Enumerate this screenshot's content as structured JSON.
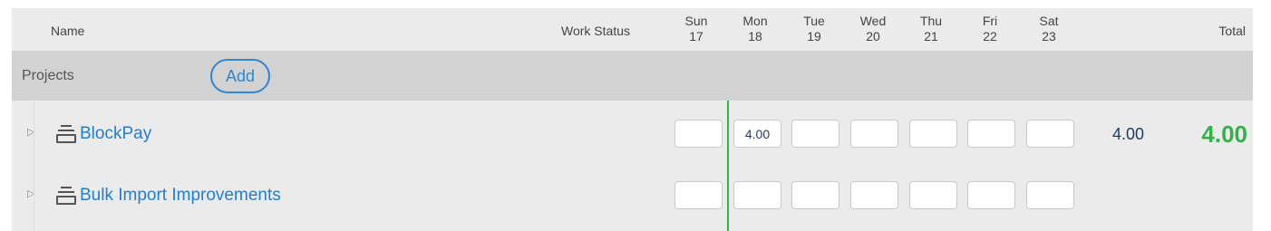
{
  "header": {
    "name": "Name",
    "work_status": "Work Status",
    "total": "Total",
    "days": [
      {
        "dow": "Sun",
        "date": "17"
      },
      {
        "dow": "Mon",
        "date": "18"
      },
      {
        "dow": "Tue",
        "date": "19"
      },
      {
        "dow": "Wed",
        "date": "20"
      },
      {
        "dow": "Thu",
        "date": "21"
      },
      {
        "dow": "Fri",
        "date": "22"
      },
      {
        "dow": "Sat",
        "date": "23"
      }
    ]
  },
  "section": {
    "title": "Projects",
    "add_label": "Add"
  },
  "rows": [
    {
      "name": "BlockPay",
      "cells": [
        "",
        "4.00",
        "",
        "",
        "",
        "",
        ""
      ],
      "row_total": "4.00",
      "grand_total": "4.00"
    },
    {
      "name": "Bulk Import Improvements",
      "cells": [
        "",
        "",
        "",
        "",
        "",
        "",
        ""
      ]
    }
  ],
  "colors": {
    "accent": "#2f86cf",
    "link": "#1e7fd1",
    "today": "#33b24a",
    "total": "#33b24a"
  }
}
